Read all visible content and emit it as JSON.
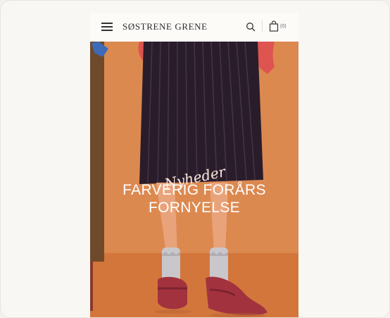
{
  "header": {
    "brand": "SØSTRENE GRENE",
    "cart_count": "(0)"
  },
  "hero": {
    "script_text": "Nyheder",
    "title_line1": "FARVERIG FORÅRS",
    "title_line2": "FORNYELSE"
  },
  "colors": {
    "background": "#d9834a",
    "floor": "#d3763c",
    "skirt": "#2b1e2c",
    "shoes": "#a3323f",
    "hands": "#e0574e"
  },
  "icons": [
    "menu-icon",
    "search-icon",
    "cart-icon"
  ]
}
